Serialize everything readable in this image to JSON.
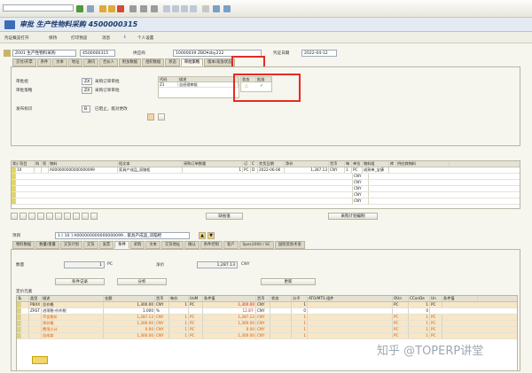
{
  "window": {
    "title": "审批 生产性物料采购 4500000315"
  },
  "toolbar": {
    "command_value": ""
  },
  "app_toolbar": {
    "buttons": [
      "凭证概览打开",
      "保持",
      "打印预览",
      "消息",
      "i",
      "个人设置"
    ]
  },
  "header": {
    "doc_type": "Z001 生产性物料采购",
    "doc_number": "4500000315",
    "vendor_label": "供应商",
    "vendor_value": "10000039 ZBD¥zby222",
    "date_label": "凭证日期",
    "date_value": "2022-04-12"
  },
  "header_tabs": [
    "交付/开票",
    "条件",
    "文本",
    "地址",
    "通讯",
    "合伙人",
    "附加数据",
    "组织数据",
    "状态",
    "审批策略",
    "版本/发放状态"
  ],
  "release": {
    "group_label": "审批组",
    "group_code": "ZX",
    "group_text": "采购订单审批",
    "strategy_label": "审批策略",
    "strategy_code": "ZX",
    "strategy_text": "采购订单审批",
    "indicator_label": "发布标识",
    "indicator_code": "B",
    "indicator_text": "已阻止，能对更改",
    "table_headers": [
      "代码",
      "描述",
      "状态",
      "批准"
    ],
    "row_code": "Z1",
    "row_desc": "总经理审批"
  },
  "items_grid": {
    "headers": [
      "状态",
      "项目",
      "科",
      "项",
      "物料",
      "短文本",
      "采购订单数量",
      "订",
      "C",
      "交货日期",
      "净价",
      "货币",
      "每",
      "单位",
      "物料组",
      "库",
      "供应商物料"
    ],
    "row": {
      "item": "10",
      "material": "A000000000000000099",
      "short_text": "家具产成品_双脑柜",
      "qty": "1",
      "unit": "PC",
      "deliv_type": "D",
      "date": "2022-06-06",
      "price": "1,287.13",
      "currency": "CNY",
      "per": "1",
      "unit2": "PC",
      "matgrp": "成熟单_宝康"
    },
    "empty_currency": "CNY"
  },
  "item_buttons": {
    "default": "缺省值",
    "plan": "采购计划编制"
  },
  "item_detail": {
    "label": "项目",
    "selector": "1 [ 10 ] A000000000000000099 , 家具产成品_双脑柜",
    "tabs": [
      "物料数据",
      "数量/重量",
      "交货计划",
      "交货",
      "发票",
      "条件",
      "采购",
      "文本",
      "交货地址",
      "确认",
      "条件控制",
      "客户",
      "Spec2000 / SC",
      "国际贸易术语"
    ],
    "qty_label": "数量",
    "qty_value": "1",
    "qty_unit": "PC",
    "price_label": "净价",
    "price_value": "1,287.13",
    "price_currency": "CNY",
    "cond_record": "条件记录",
    "analysis": "分析",
    "update": "更新"
  },
  "conditions": {
    "section_label": "定价元素",
    "headers": [
      "条.",
      "类型",
      "描述",
      "金额",
      "货币",
      "每价",
      "UoM",
      "条件值",
      "货币",
      "状态",
      "分子",
      "ATO/MTS 组件",
      "OUn",
      "CConDe",
      "Un",
      "条件值"
    ],
    "rows": [
      {
        "type": "PBXX",
        "desc": "总价格",
        "amount": "1,300.00",
        "curr": "CNY",
        "per": "1",
        "uom": "PC",
        "value": "1,300.00",
        "vcur": "CNY",
        "num": "1",
        "oun": "PC",
        "ccon": "1",
        "un": "PC"
      },
      {
        "type": "ZRST",
        "desc": "进项税-价外税",
        "amount": "1.000",
        "curr": "%",
        "per": "",
        "uom": "",
        "value": "12.87-",
        "vcur": "CNY",
        "num": "0",
        "oun": "",
        "ccon": "0",
        "un": ""
      },
      {
        "type": "",
        "desc": "不含税价",
        "amount": "1,287.13",
        "curr": "CNY",
        "per": "1",
        "uom": "PC",
        "value": "1,287.13",
        "vcur": "CNY",
        "num": "1",
        "oun": "PC",
        "ccon": "1",
        "un": "PC"
      },
      {
        "type": "",
        "desc": "净价格",
        "amount": "1,300.00",
        "curr": "CNY",
        "per": "1",
        "uom": "PC",
        "value": "1,300.00",
        "vcur": "CNY",
        "num": "1",
        "oun": "PC",
        "ccon": "1",
        "un": "PC"
      },
      {
        "type": "",
        "desc": "费用小计",
        "amount": "0.00",
        "curr": "CNY",
        "per": "1",
        "uom": "PC",
        "value": "0.00",
        "vcur": "CNY",
        "num": "1",
        "oun": "PC",
        "ccon": "1",
        "un": "PC"
      },
      {
        "type": "",
        "desc": "总成本",
        "amount": "1,300.00",
        "curr": "CNY",
        "per": "1",
        "uom": "PC",
        "value": "1,300.00",
        "vcur": "CNY",
        "num": "1",
        "oun": "PC",
        "ccon": "1",
        "un": "PC"
      }
    ]
  },
  "watermark": "知乎 @TOPERP讲堂"
}
